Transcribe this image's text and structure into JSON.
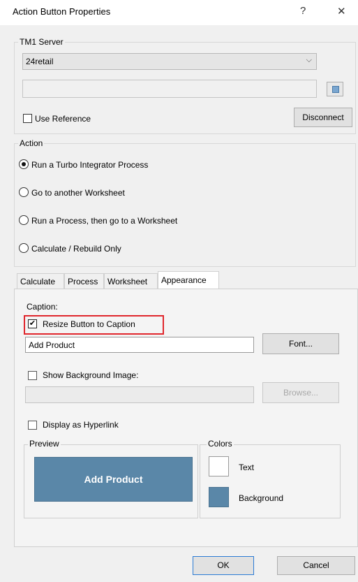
{
  "window": {
    "title": "Action Button Properties",
    "help_glyph": "?",
    "close_glyph": "✕"
  },
  "server": {
    "legend": "TM1 Server",
    "selected": "24retail",
    "second_value": "",
    "use_reference_label": "Use Reference",
    "use_reference_checked": false,
    "disconnect_label": "Disconnect"
  },
  "action": {
    "legend": "Action",
    "options": [
      {
        "label": "Run a Turbo Integrator Process",
        "selected": true
      },
      {
        "label": "Go to another Worksheet",
        "selected": false
      },
      {
        "label": "Run a Process, then go to a Worksheet",
        "selected": false
      },
      {
        "label": "Calculate / Rebuild Only",
        "selected": false
      }
    ]
  },
  "tabs": [
    {
      "label": "Calculate",
      "active": false
    },
    {
      "label": "Process",
      "active": false
    },
    {
      "label": "Worksheet",
      "active": false
    },
    {
      "label": "Appearance",
      "active": true
    }
  ],
  "appearance": {
    "caption_label": "Caption:",
    "resize_label": "Resize Button to Caption",
    "resize_checked": true,
    "caption_value": "Add Product",
    "font_button": "Font...",
    "show_bg_label": "Show Background Image:",
    "bg_path": "",
    "browse_button": "Browse...",
    "hyperlink_label": "Display as Hyperlink",
    "preview_legend": "Preview",
    "preview_button_text": "Add Product",
    "colors_legend": "Colors",
    "text_color_label": "Text",
    "background_color_label": "Background",
    "text_color": "#ffffff",
    "background_color": "#5a87a8",
    "highlight_color": "#e0262c"
  },
  "footer": {
    "ok_label": "OK",
    "cancel_label": "Cancel"
  }
}
